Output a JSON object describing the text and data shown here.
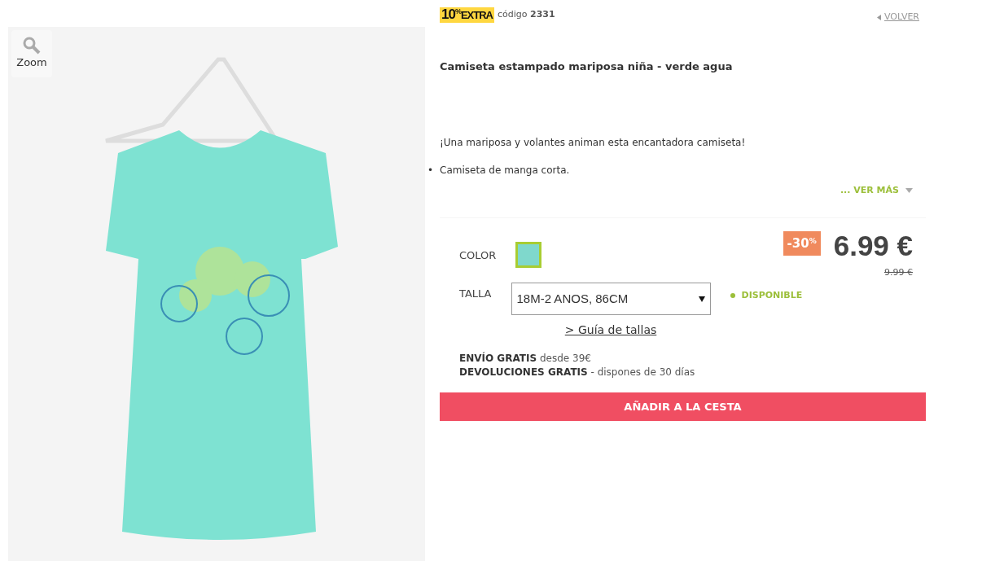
{
  "zoom": {
    "label": "Zoom"
  },
  "promo": {
    "badge_main": "10",
    "badge_sup": "%",
    "badge_word": "EXTRA",
    "code_label": "código",
    "code": "2331"
  },
  "back_link": {
    "label": "VOLVER"
  },
  "product": {
    "title": "Camiseta estampado mariposa niña - verde agua",
    "description": "¡Una mariposa y volantes animan esta encantadora camiseta!",
    "bullets": [
      {
        "marker": "•",
        "text": "Camiseta de manga corta."
      }
    ],
    "more_link": "... VER MÁS"
  },
  "color": {
    "label": "COLOR",
    "swatches": [
      {
        "color": "#7fd8cc",
        "selected": true
      }
    ]
  },
  "price": {
    "discount": "-30",
    "discount_sup": "%",
    "current": "6.99 €",
    "old": "9.99 €"
  },
  "size": {
    "label": "TALLA",
    "value": "18M-2 ANOS, 86CM",
    "guide_link": "> Guía de tallas"
  },
  "availability": {
    "label": "DISPONIBLE",
    "available": true
  },
  "shipping": [
    {
      "bold": "ENVÍO GRATIS",
      "rest": " desde 39€"
    },
    {
      "bold": "DEVOLUCIONES GRATIS",
      "rest": " - dispones de 30 días"
    }
  ],
  "add_button": {
    "label": "AÑADIR A LA CESTA"
  }
}
